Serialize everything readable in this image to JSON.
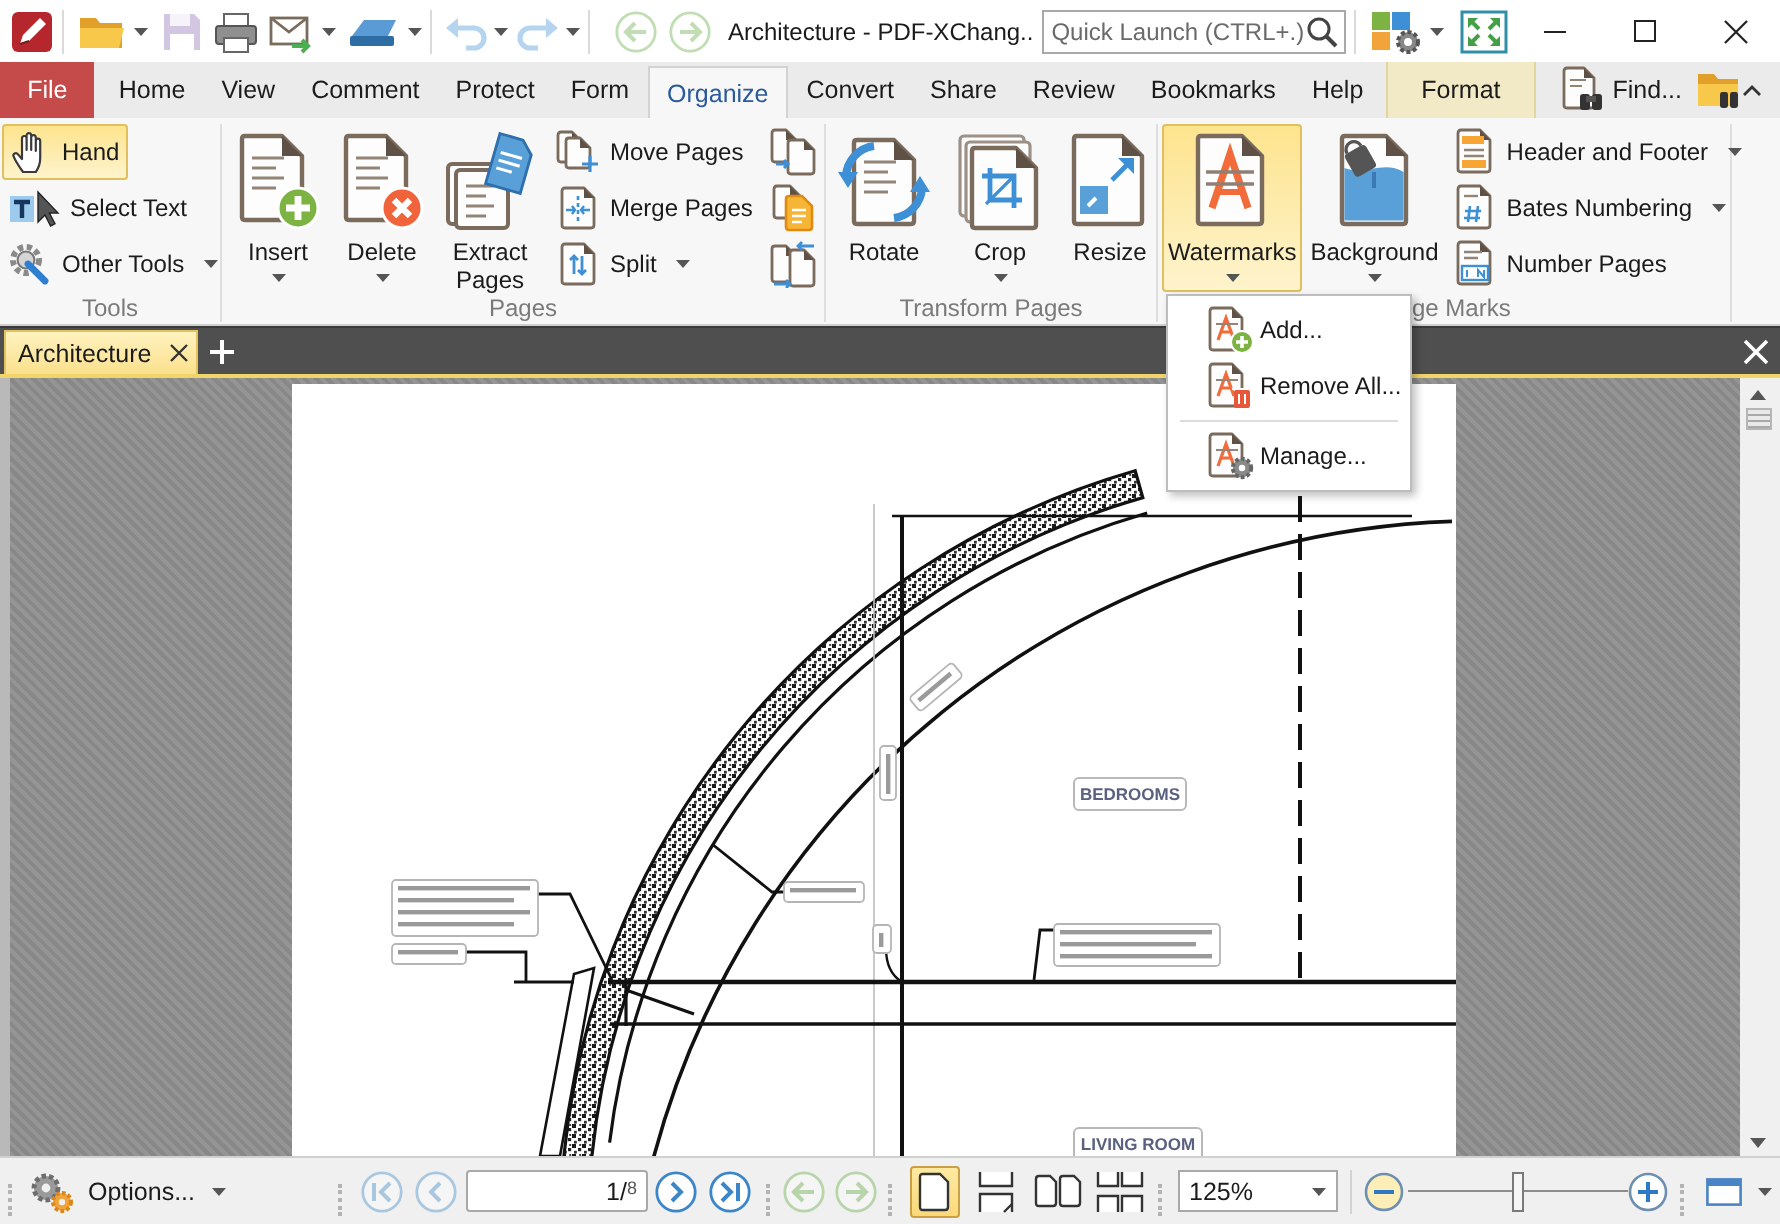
{
  "title_bar": {
    "title": "Architecture - PDF-XChang..",
    "quick_launch": {
      "placeholder": "Quick Launch (CTRL+.)"
    },
    "save": {
      "disabled": true
    },
    "undo": {
      "disabled": true
    },
    "redo": {
      "disabled": true
    },
    "back": {
      "disabled": true
    },
    "forward": {
      "disabled": true
    }
  },
  "menu_tabs": [
    {
      "label": "File",
      "kind": "file",
      "selected": false
    },
    {
      "label": "Home",
      "kind": "tab",
      "selected": false
    },
    {
      "label": "View",
      "kind": "tab",
      "selected": false
    },
    {
      "label": "Comment",
      "kind": "tab",
      "selected": false
    },
    {
      "label": "Protect",
      "kind": "tab",
      "selected": false
    },
    {
      "label": "Form",
      "kind": "tab",
      "selected": false
    },
    {
      "label": "Organize",
      "kind": "tab",
      "selected": true
    },
    {
      "label": "Convert",
      "kind": "tab",
      "selected": false
    },
    {
      "label": "Share",
      "kind": "tab",
      "selected": false
    },
    {
      "label": "Review",
      "kind": "tab",
      "selected": false
    },
    {
      "label": "Bookmarks",
      "kind": "tab",
      "selected": false
    },
    {
      "label": "Help",
      "kind": "tab",
      "selected": false
    },
    {
      "label": "Format",
      "kind": "context",
      "selected": false
    }
  ],
  "find": {
    "label": "Find..."
  },
  "ribbon": [
    {
      "label": "Tools",
      "buttons": [
        {
          "label": "Hand",
          "kind": "small",
          "dropdown": false,
          "selected": true
        },
        {
          "label": "Select Text",
          "kind": "small",
          "dropdown": false,
          "selected": false
        },
        {
          "label": "Other Tools",
          "kind": "small",
          "dropdown": true,
          "selected": false
        }
      ]
    },
    {
      "label": "Pages",
      "buttons": [
        {
          "label": "Insert",
          "kind": "large",
          "dropdown": true,
          "selected": false
        },
        {
          "label": "Delete",
          "kind": "large",
          "dropdown": true,
          "selected": false
        },
        {
          "label": "Extract Pages",
          "kind": "large",
          "dropdown": false,
          "selected": false
        },
        {
          "label": "Move Pages",
          "kind": "small",
          "dropdown": false,
          "selected": false
        },
        {
          "label": "Merge Pages",
          "kind": "small",
          "dropdown": false,
          "selected": false
        },
        {
          "label": "Split",
          "kind": "small",
          "dropdown": true,
          "selected": false
        },
        {
          "kind": "icon",
          "selected": false
        },
        {
          "kind": "icon",
          "selected": false
        },
        {
          "kind": "icon",
          "selected": false
        }
      ]
    },
    {
      "label": "Transform Pages",
      "buttons": [
        {
          "label": "Rotate",
          "kind": "large",
          "dropdown": false,
          "selected": false
        },
        {
          "label": "Crop",
          "kind": "large",
          "dropdown": true,
          "selected": false
        },
        {
          "label": "Resize",
          "kind": "large",
          "dropdown": false,
          "selected": false
        }
      ]
    },
    {
      "label": "ge Marks",
      "buttons": [
        {
          "label": "Watermarks",
          "kind": "large",
          "dropdown": true,
          "selected": true
        },
        {
          "label": "Background",
          "kind": "large",
          "dropdown": true,
          "selected": false
        },
        {
          "label": "Header and Footer",
          "kind": "small",
          "dropdown": true,
          "selected": false
        },
        {
          "label": "Bates Numbering",
          "kind": "small",
          "dropdown": true,
          "selected": false
        },
        {
          "label": "Number Pages",
          "kind": "small",
          "dropdown": false,
          "selected": false
        }
      ]
    }
  ],
  "watermarks_menu": [
    {
      "kind": "item",
      "label": "Add..."
    },
    {
      "kind": "item",
      "label": "Remove All..."
    },
    {
      "kind": "separator"
    },
    {
      "kind": "item",
      "label": "Manage..."
    }
  ],
  "document_tabs": [
    {
      "label": "Architecture",
      "selected": true
    }
  ],
  "document": {
    "room_labels": [
      "BEDROOMS",
      "LIVING ROOM"
    ]
  },
  "status_bar": {
    "options": {
      "label": "Options..."
    },
    "first_page": {
      "disabled": true
    },
    "previous_page": {
      "disabled": true
    },
    "page_field": {
      "value": "1/$^{8}$"
    },
    "next_page": {
      "disabled": false
    },
    "last_page": {
      "disabled": false
    },
    "back": {
      "disabled": true
    },
    "forward": {
      "disabled": true
    },
    "view_modes": [
      {
        "selected": true
      },
      {
        "selected": false
      },
      {
        "selected": false
      },
      {
        "selected": false
      }
    ],
    "zoom": {
      "value": "125%"
    },
    "zoom_slider": {
      "level": 0.5
    }
  }
}
